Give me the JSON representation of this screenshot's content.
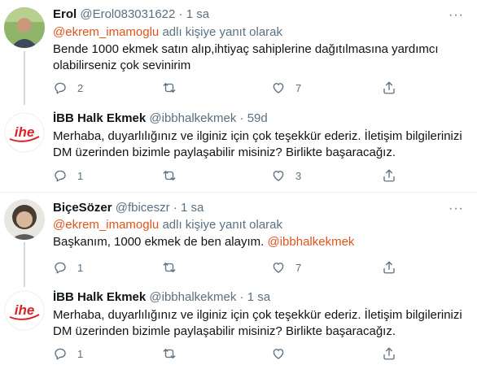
{
  "tweets": [
    {
      "name": "Erol",
      "handle": "@Erol083031622",
      "dot": "·",
      "time": "1 sa",
      "reply_handle": "@ekrem_imamoglu",
      "reply_suffix": " adlı kişiye yanıt olarak",
      "text": "Bende 1000 ekmek satın alıp,ihtiyaç sahiplerine dağıtılmasına yardımcı olabilirseniz çok sevinirim",
      "replies": "2",
      "retweets": "",
      "likes": "7"
    },
    {
      "name": "İBB Halk Ekmek",
      "handle": "@ibbhalkekmek",
      "dot": "·",
      "time": "59d",
      "text": "Merhaba, duyarlılığınız ve ilginiz için çok teşekkür ederiz. İletişim bilgilerinizi DM üzerinden bizimle paylaşabilir misiniz? Birlikte başaracağız.",
      "replies": "1",
      "retweets": "",
      "likes": "3",
      "avatar_text": "ihe"
    },
    {
      "name": "BiçeSözer",
      "handle": "@fbiceszr",
      "dot": "·",
      "time": "1 sa",
      "reply_handle": "@ekrem_imamoglu",
      "reply_suffix": " adlı kişiye yanıt olarak",
      "text_prefix": "Başkanım, 1000 ekmek de ben alayım. ",
      "text_mention": "@ibbhalkekmek",
      "replies": "1",
      "retweets": "",
      "likes": "7"
    },
    {
      "name": "İBB Halk Ekmek",
      "handle": "@ibbhalkekmek",
      "dot": "·",
      "time": "1 sa",
      "text": "Merhaba, duyarlılığınız ve ilginiz için çok teşekkür ederiz. İletişim bilgilerinizi DM üzerinden bizimle paylaşabilir misiniz? Birlikte başaracağız.",
      "replies": "1",
      "retweets": "",
      "likes": "",
      "avatar_text": "ihe"
    }
  ],
  "more_label": "···",
  "colors": {
    "link": "#e0541b",
    "muted": "#5b7083",
    "brand_red": "#d8232a"
  }
}
